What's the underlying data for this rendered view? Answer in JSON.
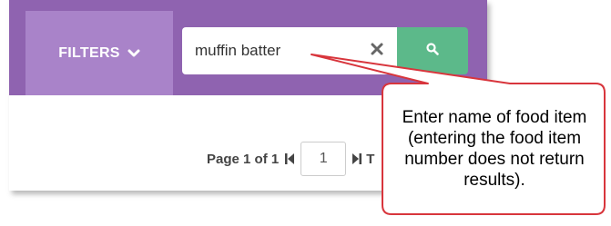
{
  "toolbar": {
    "filters_label": "FILTERS",
    "filters_icon": "chevron-down-icon",
    "search_value": "muffin batter",
    "clear_icon": "close-icon",
    "search_icon": "search-icon"
  },
  "pager": {
    "label": "Page 1 of 1",
    "page_value": "1",
    "tail_text": "T"
  },
  "callout": {
    "text": "Enter name of food item (entering the food item number does not return results)."
  },
  "colors": {
    "bar": "#8f63b0",
    "filters_button": "#a983c9",
    "search_button": "#5cb98a",
    "callout_border": "#d8353c"
  }
}
